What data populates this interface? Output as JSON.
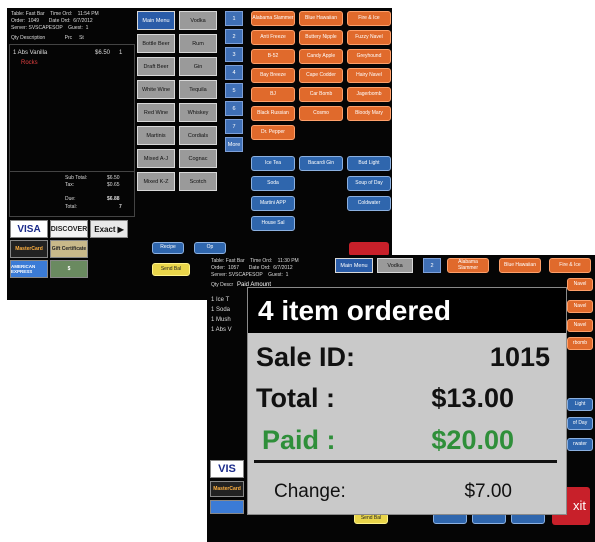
{
  "pos1": {
    "header": [
      "Table: Fast Bar    Time Ord:    11:54 PM",
      "Order:  1049       Date Ord:  6/7/2012",
      "Server: SVSCAPESOP    Guest:  1",
      "Qty Description              Prc     St"
    ],
    "line_item": {
      "qty_desc": "1 Abs Vanilla",
      "price": "$6.50",
      "st": "1"
    },
    "line_note": "Rocks",
    "subtotal_label": "Sub Total:",
    "subtotal_value": "$6.50",
    "tax_label": "Tax:",
    "tax_value": "$0.65",
    "due_label": "Due:",
    "due_value": "$6.88",
    "total_label": "Total:",
    "total_value": "7",
    "categories": [
      "Main Menu",
      "Vodka",
      "Bottle Beer",
      "Rum",
      "Draft Beer",
      "Gin",
      "White Wine",
      "Tequila",
      "Red Wine",
      "Whiskey",
      "Martinis",
      "Cordials",
      "Mixed A-J",
      "Cognac",
      "Mixed K-Z",
      "Scotch"
    ],
    "numbers": [
      "1",
      "2",
      "3",
      "4",
      "5",
      "6",
      "7",
      "More"
    ],
    "orange_items": [
      "Alabama Slammer",
      "Blue Hawaiian",
      "Fire & Ice",
      "Anti Freeze",
      "Buttery Nipple",
      "Fuzzy Navel",
      "B-52",
      "Candy Apple",
      "Greyhound",
      "Bay Breeze",
      "Cape Codder",
      "Hairy Navel",
      "BJ",
      "Car Bomb",
      "Jagerbomb",
      "Black Russian",
      "Cosmo",
      "Bloody Mary",
      "Dr. Pepper"
    ],
    "blue_items": [
      "Ice Tea",
      "Bacardi Gin",
      "Bud Light",
      "Soda",
      "Soup of Day",
      "Martini APP",
      "Coldwater",
      "House Sal"
    ],
    "cards": {
      "visa": "VISA",
      "discover": "DISCOVER",
      "exact": "Exact",
      "mastercard": "MasterCard",
      "gift": "Gift Certificate",
      "amex": "AMERICAN EXPRESS"
    },
    "buttons": {
      "recipe": "Recipe",
      "send": "Send Bal",
      "op": "Op"
    }
  },
  "pos2": {
    "header": [
      "Table: Fast Bar    Time Ord:    11:30 PM",
      "Order:  1057       Date Ord:  6/7/2012",
      "Server: SVSCAPESOP    Guest:  1",
      "Qty Descr"
    ],
    "paid_amount_label": "Paid Amount",
    "partial_lines": [
      "1 Ice T",
      "1 Soda",
      "1 Mush",
      "1 Abs V"
    ],
    "categories": [
      "Main Menu",
      "Vodka",
      "2"
    ],
    "orange_items": [
      "Alabama Slammer",
      "Blue Hawaiian",
      "Fire & Ice"
    ],
    "side_labels": [
      "Navel",
      "Navel",
      "Navel",
      "rbomb"
    ],
    "blue_side": [
      "Light",
      "of Day",
      "rwater"
    ],
    "exit_label": "xit",
    "send_label": "Send Bal",
    "visa": "VIS",
    "mastercard": "MasterCard"
  },
  "popup": {
    "title": "4 item ordered",
    "sale_id_label": "Sale ID:",
    "sale_id_value": "1015",
    "total_label": "Total :",
    "total_value": "$13.00",
    "paid_label": "Paid  :",
    "paid_value": "$20.00",
    "change_label": "Change:",
    "change_value": "$7.00",
    "colors": {
      "paid": "#2f8f3a",
      "title_bg": "#000000",
      "panel_bg": "#c9c9c9"
    }
  }
}
